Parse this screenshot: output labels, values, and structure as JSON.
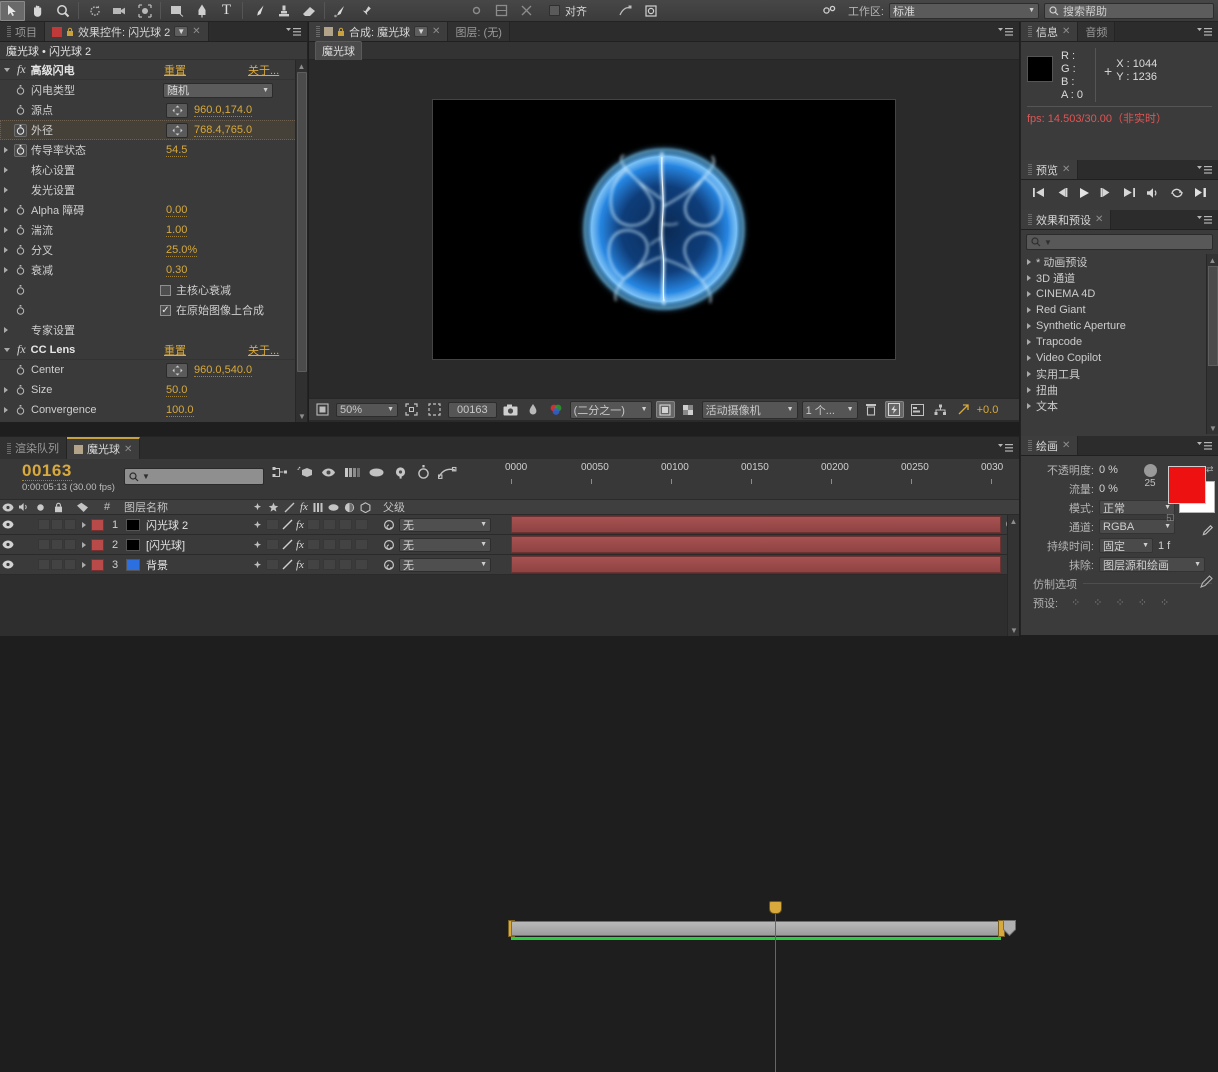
{
  "toolbar": {
    "tools": [
      "selection-tool",
      "hand-tool",
      "zoom-tool",
      "rotation-tool",
      "camera-tool",
      "pan-behind-tool",
      "shape-tool",
      "pen-tool",
      "text-tool",
      "brush-tool",
      "clone-stamp-tool",
      "eraser-tool",
      "roto-brush-tool",
      "puppet-tool"
    ],
    "align_label": "对齐",
    "workspace_label": "工作区:",
    "workspace_value": "标准",
    "help_placeholder": "搜索帮助"
  },
  "effect_controls": {
    "tabs": [
      {
        "label": "项目",
        "active": false
      },
      {
        "label": "效果控件: 闪光球 2",
        "active": true
      }
    ],
    "breadcrumb": "魔光球 • 闪光球 2",
    "effects": [
      {
        "name": "高级闪电",
        "reset": "重置",
        "about": "关于...",
        "properties": [
          {
            "label": "闪电类型",
            "type": "dropdown",
            "value": "随机",
            "stopwatch": false,
            "twirl": false,
            "highlight": false
          },
          {
            "label": "源点",
            "type": "point",
            "value": "960.0,174.0",
            "stopwatch": false,
            "twirl": false,
            "highlight": false
          },
          {
            "label": "外径",
            "type": "point",
            "value": "768.4,765.0",
            "stopwatch": true,
            "twirl": false,
            "highlight": true
          },
          {
            "label": "传导率状态",
            "type": "value",
            "value": "54.5",
            "stopwatch": true,
            "twirl": true,
            "highlight": false
          },
          {
            "label": "核心设置",
            "type": "group",
            "value": "",
            "stopwatch": false,
            "twirl": true,
            "highlight": false
          },
          {
            "label": "发光设置",
            "type": "group",
            "value": "",
            "stopwatch": false,
            "twirl": true,
            "highlight": false
          },
          {
            "label": "Alpha 障碍",
            "type": "value",
            "value": "0.00",
            "stopwatch": true,
            "twirl": true,
            "highlight": false
          },
          {
            "label": "湍流",
            "type": "value",
            "value": "1.00",
            "stopwatch": true,
            "twirl": true,
            "highlight": false
          },
          {
            "label": "分叉",
            "type": "value",
            "value": "25.0%",
            "stopwatch": true,
            "twirl": true,
            "highlight": false
          },
          {
            "label": "衰减",
            "type": "value",
            "value": "0.30",
            "stopwatch": true,
            "twirl": true,
            "highlight": false
          },
          {
            "label": "主核心衰减",
            "type": "checkbox",
            "value": "",
            "checked": false,
            "stopwatch": true,
            "twirl": false,
            "highlight": false
          },
          {
            "label": "在原始图像上合成",
            "type": "checkbox",
            "value": "",
            "checked": true,
            "stopwatch": true,
            "twirl": false,
            "highlight": false
          },
          {
            "label": "专家设置",
            "type": "group",
            "value": "",
            "stopwatch": false,
            "twirl": true,
            "highlight": false
          }
        ]
      },
      {
        "name": "CC Lens",
        "reset": "重置",
        "about": "关于...",
        "properties": [
          {
            "label": "Center",
            "type": "point",
            "value": "960.0,540.0",
            "stopwatch": true,
            "twirl": false,
            "highlight": false
          },
          {
            "label": "Size",
            "type": "value",
            "value": "50.0",
            "stopwatch": true,
            "twirl": true,
            "highlight": false
          },
          {
            "label": "Convergence",
            "type": "value",
            "value": "100.0",
            "stopwatch": true,
            "twirl": true,
            "highlight": false
          }
        ]
      }
    ]
  },
  "composition": {
    "tabs": [
      {
        "label": "合成: 魔光球",
        "active": true
      },
      {
        "label": "图层: (无)",
        "active": false
      }
    ],
    "breadcrumb": "魔光球",
    "footer": {
      "magnification": "50%",
      "timecode": "00163",
      "resolution": "(二分之一)",
      "camera": "活动摄像机",
      "views": "1 个...",
      "exposure": "+0.0"
    }
  },
  "info": {
    "tabs": [
      {
        "label": "信息",
        "active": true
      },
      {
        "label": "音频",
        "active": false
      }
    ],
    "channels": [
      "R :",
      "G :",
      "B :",
      "A : 0"
    ],
    "x_label": "X : 1044",
    "y_label": "Y : 1236",
    "fps": "fps: 14.503/30.00（非实时）"
  },
  "preview": {
    "tabs": [
      {
        "label": "预览",
        "active": true
      }
    ],
    "buttons": [
      "first-frame",
      "prev-frame",
      "play",
      "next-frame",
      "last-frame",
      "audio-toggle",
      "loop",
      "ram-preview"
    ]
  },
  "effects_presets": {
    "tabs": [
      {
        "label": "效果和预设",
        "active": true
      }
    ],
    "search_value": "",
    "items": [
      "* 动画预设",
      "3D 通道",
      "CINEMA 4D",
      "Red Giant",
      "Synthetic Aperture",
      "Trapcode",
      "Video Copilot",
      "实用工具",
      "扭曲",
      "文本"
    ]
  },
  "paint": {
    "tabs": [
      {
        "label": "绘画",
        "active": true
      }
    ],
    "rows": [
      {
        "label": "不透明度:",
        "value": "0 %",
        "type": "value"
      },
      {
        "label": "流量:",
        "value": "0 %",
        "type": "value"
      },
      {
        "label": "模式:",
        "value": "正常",
        "type": "dropdown"
      },
      {
        "label": "通道:",
        "value": "RGBA",
        "type": "dropdown"
      },
      {
        "label": "持续时间:",
        "value": "固定",
        "type": "dropdown",
        "extra": "1 f"
      },
      {
        "label": "抹除:",
        "value": "图层源和绘画",
        "type": "dropdown"
      },
      {
        "label": "仿制选项",
        "value": "",
        "type": "section"
      },
      {
        "label": "预设:",
        "value": "",
        "type": "presets"
      }
    ],
    "brush_size": "25",
    "foreground_color": "#ee1111",
    "background_color": "#ffffff"
  },
  "timeline": {
    "tabs": [
      {
        "label": "渲染队列",
        "active": false
      },
      {
        "label": "魔光球",
        "active": true
      }
    ],
    "current_frame": "00163",
    "current_time": "0:00:05:13 (30.00 fps)",
    "search_value": "",
    "column_headers": [
      "图层名称",
      "父级"
    ],
    "ruler_marks": [
      "0000",
      "00050",
      "00100",
      "00150",
      "00200",
      "00250",
      "0030"
    ],
    "layers": [
      {
        "index": "1",
        "name": "闪光球 2",
        "color": "#b84a4a",
        "source_color": "#000000",
        "parent": "无"
      },
      {
        "index": "2",
        "name": "[闪光球]",
        "color": "#b84a4a",
        "source_color": "#000000",
        "parent": "无"
      },
      {
        "index": "3",
        "name": "背景",
        "color": "#b84a4a",
        "source_color": "#2b6fe0",
        "parent": "无"
      }
    ]
  },
  "colors": {
    "accent_orange": "#d8a93c",
    "bar_red": "#9e4a4a",
    "work_area_green": "#2ecc40",
    "cti_red": "#e03030",
    "panel_bg": "#3a3a3a"
  }
}
